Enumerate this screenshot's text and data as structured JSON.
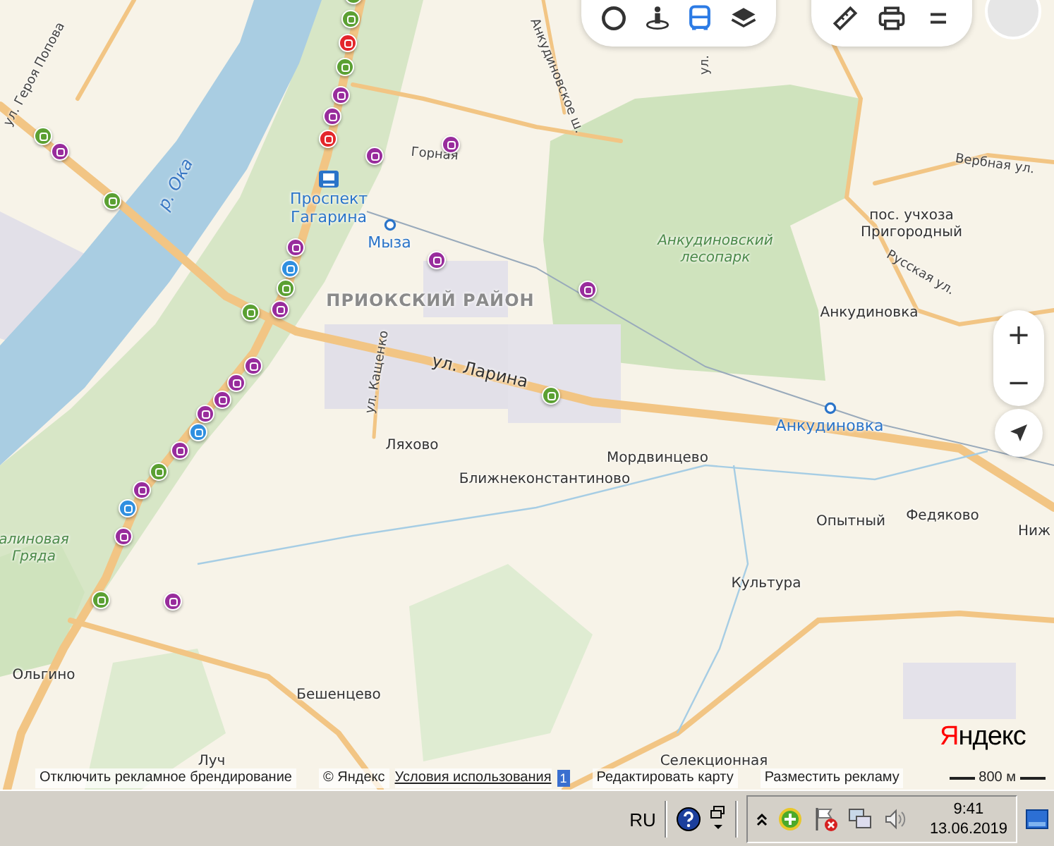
{
  "map_toolbar": [
    {
      "kind": "traffic",
      "selected": false
    },
    {
      "kind": "panorama",
      "selected": false
    },
    {
      "kind": "transit",
      "selected": true
    },
    {
      "kind": "layers",
      "selected": false
    }
  ],
  "map_tools": [
    {
      "kind": "ruler"
    },
    {
      "kind": "print"
    },
    {
      "kind": "menu"
    }
  ],
  "zoom_controls": {
    "zoom_in": "+",
    "zoom_out": "−"
  },
  "labels": [
    {
      "text": "ул. Героя Попова",
      "kind": "street"
    },
    {
      "text": "р. Ока",
      "kind": "water"
    },
    {
      "text": "Анкудиновское ш.",
      "kind": "street"
    },
    {
      "text": "ул.",
      "kind": "street"
    },
    {
      "text": "Горная",
      "kind": "street"
    },
    {
      "text": "Проспект Гагарина",
      "kind": "station"
    },
    {
      "text": "Мыза",
      "kind": "station"
    },
    {
      "text": "ПРИОКСКИЙ РАЙОН",
      "kind": "district"
    },
    {
      "text": "ул. Кащенко",
      "kind": "street"
    },
    {
      "text": "ул. Ларина",
      "kind": "major_street"
    },
    {
      "text": "Ляхово",
      "kind": "place"
    },
    {
      "text": "Ближнеконстантиново",
      "kind": "place"
    },
    {
      "text": "Мордвинцево",
      "kind": "place"
    },
    {
      "text": "Анкудиновский лесопарк",
      "kind": "park"
    },
    {
      "text": "Вербная ул.",
      "kind": "street"
    },
    {
      "text": "пос. учхоза Пригородный",
      "kind": "place"
    },
    {
      "text": "Русская ул.",
      "kind": "street"
    },
    {
      "text": "Анкудиновка",
      "kind": "place"
    },
    {
      "text": "Анкудиновка",
      "kind": "station"
    },
    {
      "text": "Опытный",
      "kind": "place"
    },
    {
      "text": "Федяково",
      "kind": "place"
    },
    {
      "text": "Ниж",
      "kind": "place"
    },
    {
      "text": "Культура",
      "kind": "place"
    },
    {
      "text": "Селекционная",
      "kind": "place"
    },
    {
      "text": "Бешенцево",
      "kind": "place"
    },
    {
      "text": "Ольгино",
      "kind": "place"
    },
    {
      "text": "Луч",
      "kind": "place"
    },
    {
      "text": "алиновая Гряда",
      "kind": "park"
    }
  ],
  "stops": [
    {
      "color": "#5ba033"
    },
    {
      "color": "#5ba033"
    },
    {
      "color": "#e3262b"
    },
    {
      "color": "#5ba033"
    },
    {
      "color": "#982c9c"
    },
    {
      "color": "#982c9c"
    },
    {
      "color": "#e3262b"
    },
    {
      "color": "#982c9c"
    },
    {
      "color": "#982c9c"
    },
    {
      "color": "#5ba033"
    },
    {
      "color": "#982c9c"
    },
    {
      "color": "#5ba033"
    },
    {
      "color": "#982c9c"
    },
    {
      "color": "#2f8fe0"
    },
    {
      "color": "#5ba033"
    },
    {
      "color": "#982c9c"
    },
    {
      "color": "#5ba033"
    },
    {
      "color": "#982c9c"
    },
    {
      "color": "#982c9c"
    },
    {
      "color": "#5ba033"
    },
    {
      "color": "#982c9c"
    },
    {
      "color": "#982c9c"
    },
    {
      "color": "#982c9c"
    },
    {
      "color": "#2f8fe0"
    },
    {
      "color": "#982c9c"
    },
    {
      "color": "#5ba033"
    },
    {
      "color": "#982c9c"
    },
    {
      "color": "#2f8fe0"
    },
    {
      "color": "#982c9c"
    },
    {
      "color": "#982c9c"
    },
    {
      "color": "#5ba033"
    },
    {
      "color": "#982c9c"
    }
  ],
  "logo": "Яндекс",
  "scale": "800 м",
  "footer": {
    "branding_link": "Отключить рекламное брендирование",
    "copyright": "© Яндекс",
    "terms_link": "Условия использования",
    "badge": "1",
    "edit_link": "Редактировать карту",
    "ads_link": "Разместить рекламу"
  },
  "taskbar": {
    "language": "RU",
    "time": "9:41",
    "date": "13.06.2019"
  }
}
